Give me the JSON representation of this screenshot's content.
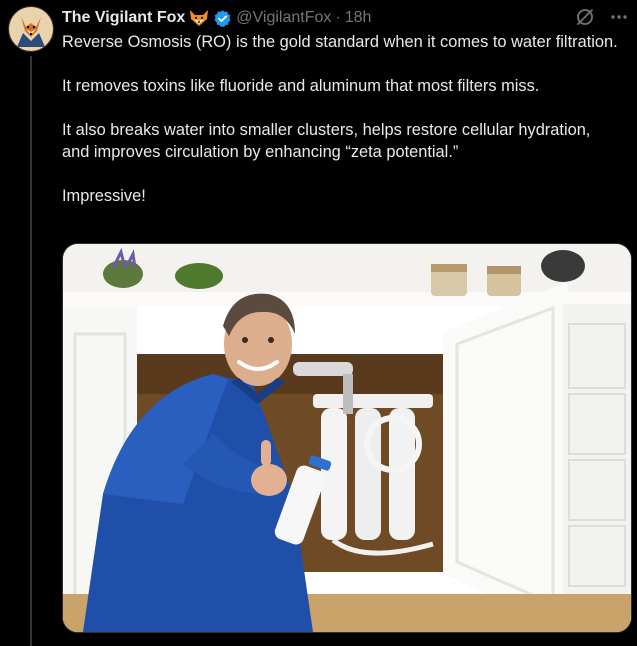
{
  "tweet": {
    "display_name": "The Vigilant Fox",
    "handle": "@VigilantFox",
    "separator": "·",
    "time": "18h",
    "paragraphs": [
      "Reverse Osmosis (RO) is the gold standard when it comes to water filtration.",
      "It removes toxins like fluoride and aluminum that most filters miss.",
      "It also breaks water into smaller clusters, helps restore cellular hydration, and improves circulation by enhancing “zeta potential.”",
      "Impressive!"
    ]
  },
  "icons": {
    "avatar": "fox-avatar",
    "name_emoji": "fox-face-icon",
    "verified": "verified-badge-icon",
    "grok": "grok-icon",
    "more": "more-options-icon"
  },
  "colors": {
    "background": "#000000",
    "text_primary": "#e7e9ea",
    "text_secondary": "#71767b",
    "verified_blue": "#1d9bf0",
    "thread_line": "#333639"
  },
  "media": {
    "type": "photo",
    "subject": "plumber-with-reverse-osmosis-filter"
  }
}
